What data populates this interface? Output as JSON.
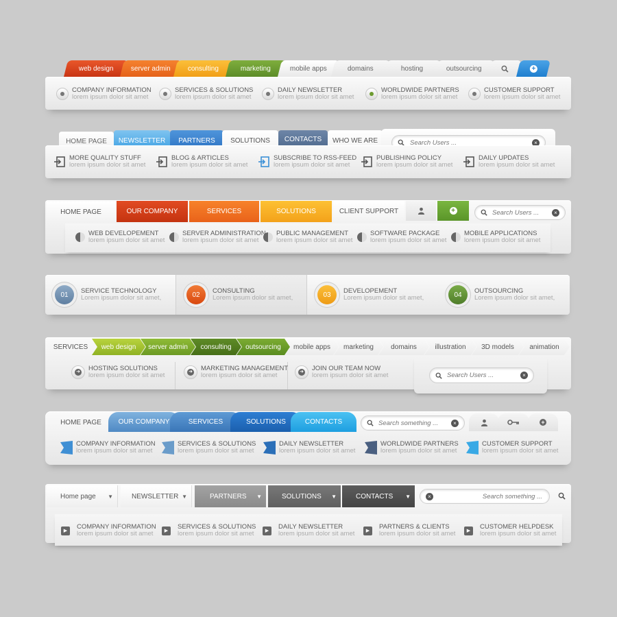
{
  "nav1": {
    "tabs": [
      {
        "label": "web design",
        "color": "#d8411c"
      },
      {
        "label": "server admin",
        "color": "#ef6d1d"
      },
      {
        "label": "consulting",
        "color": "#f6a91d"
      },
      {
        "label": "marketing",
        "color": "#6d9b30"
      },
      {
        "label": "mobile apps"
      },
      {
        "label": "domains"
      },
      {
        "label": "hosting"
      },
      {
        "label": "outsourcing"
      }
    ],
    "items": [
      {
        "title": "COMPANY INFORMATION",
        "desc": "lorem ipsum dolor sit amet"
      },
      {
        "title": "SERVICES & SOLUTIONS",
        "desc": "lorem ipsum dolor sit amet"
      },
      {
        "title": "DAILY NEWSLETTER",
        "desc": "lorem ipsum dolor sit amet"
      },
      {
        "title": "WORLDWIDE PARTNERS",
        "desc": "lorem ipsum dolor sit amet"
      },
      {
        "title": "CUSTOMER SUPPORT",
        "desc": "lorem ipsum dolor sit amet"
      }
    ]
  },
  "nav2": {
    "tabs": [
      "HOME PAGE",
      "NEWSLETTER",
      "PARTNERS",
      "SOLUTIONS",
      "CONTACTS",
      "WHO WE ARE"
    ],
    "search_placeholder": "Search Users ...",
    "items": [
      {
        "title": "MORE QUALITY STUFF",
        "desc": "lorem ipsum dolor sit amet"
      },
      {
        "title": "BLOG & ARTICLES",
        "desc": "lorem ipsum dolor sit amet"
      },
      {
        "title": "SUBSCRIBE TO RSS-FEED",
        "desc": "lorem ipsum dolor sit amet"
      },
      {
        "title": "PUBLISHING POLICY",
        "desc": "lorem ipsum dolor sit amet"
      },
      {
        "title": "DAILY UPDATES",
        "desc": "lorem ipsum dolor sit amet"
      }
    ]
  },
  "nav3": {
    "tabs": [
      "HOME PAGE",
      "OUR COMPANY",
      "SERVICES",
      "SOLUTIONS",
      "CLIENT SUPPORT"
    ],
    "search_placeholder": "Search Users ...",
    "items": [
      {
        "title": "WEB DEVELOPEMENT",
        "desc": "lorem ipsum dolor sit amet"
      },
      {
        "title": "SERVER ADMINISTRATION",
        "desc": "lorem ipsum dolor sit amet"
      },
      {
        "title": "PUBLIC MANAGEMENT",
        "desc": "lorem ipsum dolor sit amet"
      },
      {
        "title": "SOFTWARE PACKAGE",
        "desc": "lorem ipsum dolor sit amet"
      },
      {
        "title": "MOBILE APPLICATIONS",
        "desc": "lorem ipsum dolor sit amet"
      }
    ]
  },
  "nav4": {
    "items": [
      {
        "num": "01",
        "title": "SERVICE TECHNOLOGY",
        "desc": "Lorem ipsum dolor sit amet,",
        "color": "#6f8fb0"
      },
      {
        "num": "02",
        "title": "CONSULTING",
        "desc": "Lorem ipsum dolor sit amet,",
        "color": "#e2561a"
      },
      {
        "num": "03",
        "title": "DEVELOPEMENT",
        "desc": "Lorem ipsum dolor sit amet,",
        "color": "#f2a31a"
      },
      {
        "num": "04",
        "title": "OUTSOURCING",
        "desc": "Lorem ipsum dolor sit amet,",
        "color": "#5e8e34"
      }
    ]
  },
  "nav5": {
    "tabs": [
      "SERVICES",
      "web design",
      "server admin",
      "consulting",
      "outsourcing",
      "mobile apps",
      "marketing",
      "domains",
      "illustration",
      "3D models",
      "animation"
    ],
    "search_placeholder": "Search Users ...",
    "items": [
      {
        "title": "HOSTING SOLUTIONS",
        "desc": "lorem ipsum dolor sit amet"
      },
      {
        "title": "MARKETING MANAGEMENT",
        "desc": "lorem ipsum dolor sit amet"
      },
      {
        "title": "JOIN OUR TEAM NOW",
        "desc": "lorem ipsum dolor sit amet"
      }
    ]
  },
  "nav6": {
    "tabs": [
      "HOME PAGE",
      "OUR COMPANY",
      "SERVICES",
      "SOLUTIONS",
      "CONTACTS"
    ],
    "search_placeholder": "Search something ...",
    "items": [
      {
        "title": "COMPANY INFORMATION",
        "desc": "lorem ipsum dolor sit amet"
      },
      {
        "title": "SERVICES & SOLUTIONS",
        "desc": "lorem ipsum dolor sit amet"
      },
      {
        "title": "DAILY NEWSLETTER",
        "desc": "lorem ipsum dolor sit amet"
      },
      {
        "title": "WORLDWIDE PARTNERS",
        "desc": "lorem ipsum dolor sit amet"
      },
      {
        "title": "CUSTOMER SUPPORT",
        "desc": "lorem ipsum dolor sit amet"
      }
    ]
  },
  "nav7": {
    "tabs": [
      "Home page",
      "NEWSLETTER",
      "PARTNERS",
      "SOLUTIONS",
      "CONTACTS"
    ],
    "search_placeholder": "Search something ...",
    "items": [
      {
        "title": "COMPANY INFORMATION",
        "desc": "lorem ipsum dolor sit amet"
      },
      {
        "title": "SERVICES & SOLUTIONS",
        "desc": "lorem ipsum dolor sit amet"
      },
      {
        "title": "DAILY NEWSLETTER",
        "desc": "lorem ipsum dolor sit amet"
      },
      {
        "title": "PARTNERS & CLIENTS",
        "desc": "lorem ipsum dolor sit amet"
      },
      {
        "title": "CUSTOMER HELPDESK",
        "desc": "lorem ipsum dolor sit amet"
      }
    ]
  }
}
